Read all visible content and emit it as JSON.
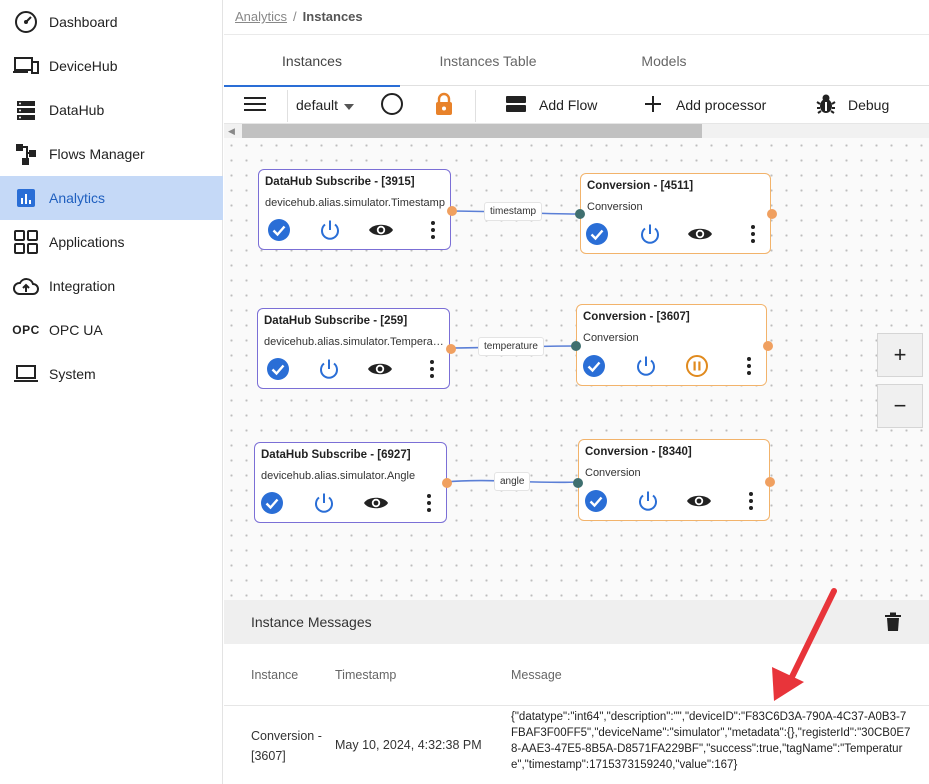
{
  "sidebar": {
    "items": [
      {
        "label": "Dashboard",
        "icon": "speedometer-icon"
      },
      {
        "label": "DeviceHub",
        "icon": "devices-icon"
      },
      {
        "label": "DataHub",
        "icon": "storage-icon"
      },
      {
        "label": "Flows Manager",
        "icon": "flows-icon"
      },
      {
        "label": "Analytics",
        "icon": "analytics-icon",
        "active": true
      },
      {
        "label": "Applications",
        "icon": "apps-grid-icon"
      },
      {
        "label": "Integration",
        "icon": "cloud-upload-icon"
      },
      {
        "label": "OPC UA",
        "icon": "opc-icon",
        "icon_text": "OPC"
      },
      {
        "label": "System",
        "icon": "laptop-icon"
      }
    ]
  },
  "breadcrumb": {
    "parent": "Analytics",
    "separator": "/",
    "current": "Instances"
  },
  "tabs": [
    {
      "label": "Instances",
      "active": true
    },
    {
      "label": "Instances Table"
    },
    {
      "label": "Models"
    }
  ],
  "toolbar": {
    "flow_select": "default",
    "add_flow": "Add Flow",
    "add_processor": "Add processor",
    "debug": "Debug"
  },
  "canvas": {
    "nodes": [
      {
        "id": "sub1",
        "title": "DataHub Subscribe - [3915]",
        "subtitle": "devicehub.alias.simulator.Timestamp"
      },
      {
        "id": "conv1",
        "title": "Conversion - [4511]",
        "subtitle": "Conversion"
      },
      {
        "id": "sub2",
        "title": "DataHub Subscribe - [259]",
        "subtitle": "devicehub.alias.simulator.Temperature"
      },
      {
        "id": "conv2",
        "title": "Conversion - [3607]",
        "subtitle": "Conversion"
      },
      {
        "id": "sub3",
        "title": "DataHub Subscribe - [6927]",
        "subtitle": "devicehub.alias.simulator.Angle"
      },
      {
        "id": "conv3",
        "title": "Conversion - [8340]",
        "subtitle": "Conversion"
      }
    ],
    "edges": [
      "timestamp",
      "temperature",
      "angle"
    ],
    "zoom_in": "+",
    "zoom_out": "−"
  },
  "messages": {
    "title": "Instance Messages",
    "columns": [
      "Instance",
      "Timestamp",
      "Message"
    ],
    "rows": [
      {
        "instance": "Conversion - [3607]",
        "timestamp": "May 10, 2024, 4:32:38 PM",
        "message": "{\"datatype\":\"int64\",\"description\":\"\",\"deviceID\":\"F83C6D3A-790A-4C37-A0B3-7FBAF3F00FF5\",\"deviceName\":\"simulator\",\"metadata\":{},\"registerId\":\"30CB0E78-AAE3-47E5-8B5A-D8571FA229BF\",\"success\":true,\"tagName\":\"Temperature\",\"timestamp\":1715373159240,\"value\":167}"
      }
    ]
  },
  "colors": {
    "accent": "#2a6ed6",
    "active_nav_bg": "#c5d9f7",
    "subscribe_border": "#7b6fd6",
    "conversion_border": "#f2b36b",
    "pause_orange": "#e08a1e",
    "lock_orange": "#e8822a",
    "annotation_arrow": "#e8343a"
  }
}
